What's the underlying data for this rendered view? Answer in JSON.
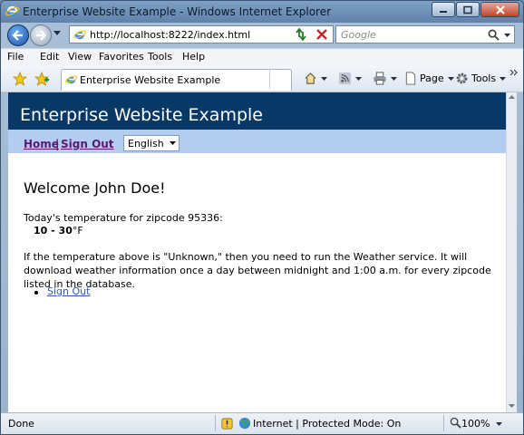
{
  "window": {
    "title": "Enterprise Website Example - Windows Internet Explorer"
  },
  "address": {
    "url": "http://localhost:8222/index.html"
  },
  "search": {
    "placeholder": "Google"
  },
  "menu": {
    "items": [
      "File",
      "Edit",
      "View",
      "Favorites",
      "Tools",
      "Help"
    ]
  },
  "tab": {
    "title": "Enterprise Website Example"
  },
  "toolbar": {
    "page_label": "Page",
    "tools_label": "Tools"
  },
  "site": {
    "title": "Enterprise Website Example",
    "nav_home": "Home",
    "nav_separator": "|",
    "nav_signout": "Sign Out",
    "language": "English"
  },
  "page": {
    "welcome": "Welcome John Doe!",
    "temp_label": "Today's temperature for zipcode 95336:",
    "temp_low": "10",
    "temp_dash": " - ",
    "temp_high": "30",
    "temp_unit": "°F",
    "info": "If the temperature above is \"Unknown,\" then you need to run the Weather service. It will download weather information once a day between midnight and 1:00 a.m. for every zipcode listed in the database.",
    "list_signout": "Sign Out"
  },
  "status": {
    "text": "Done",
    "zone": "Internet | Protected Mode: On",
    "zoom": "100%"
  }
}
